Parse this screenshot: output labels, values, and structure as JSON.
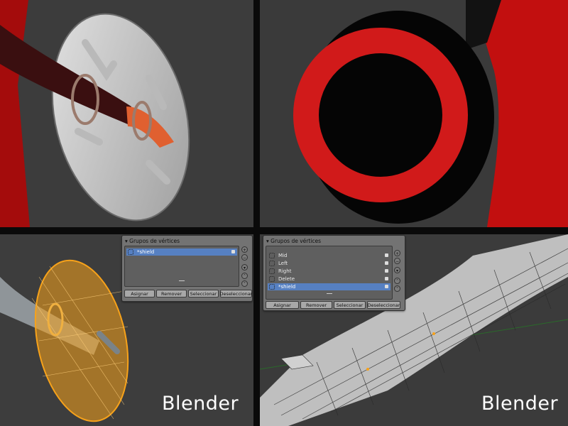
{
  "brand": {
    "left": "Blender",
    "right": "Blender"
  },
  "icons": {
    "collapse": "triangle-down-icon",
    "group": "vertex-group-icon",
    "lock": "lock-icon",
    "add": "plus-icon",
    "remove": "minus-icon",
    "more": "menu-icon",
    "up": "chevron-up-icon",
    "down": "chevron-down-icon"
  },
  "colors": {
    "selected_row": "#5680c2",
    "mesh_select": "#f7a21a",
    "shield_red": "#d11a1a"
  },
  "vg_left": {
    "title": "Grupos de vértices",
    "groups": [
      {
        "label": "*shield",
        "selected": true
      }
    ],
    "buttons": {
      "assign": "Asignar",
      "remove": "Remover",
      "select": "Seleccionar",
      "deselect": "Deseleccionar"
    }
  },
  "vg_right": {
    "title": "Grupos de vértices",
    "groups": [
      {
        "label": "Mid",
        "selected": false
      },
      {
        "label": "Left",
        "selected": false
      },
      {
        "label": "Right",
        "selected": false
      },
      {
        "label": "Delete",
        "selected": false
      },
      {
        "label": "*shield",
        "selected": true
      }
    ],
    "buttons": {
      "assign": "Asignar",
      "remove": "Remover",
      "select": "Seleccionar",
      "deselect": "Deseleccionar"
    }
  }
}
